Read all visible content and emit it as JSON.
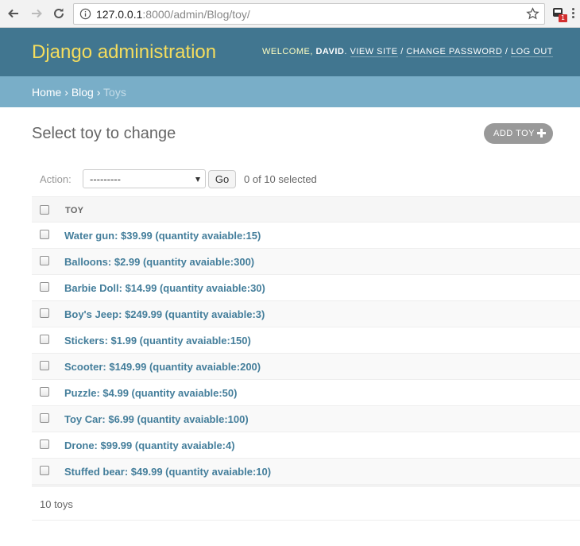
{
  "browser": {
    "url_host": "127.0.0.1",
    "url_rest": ":8000/admin/Blog/toy/",
    "extension_badge": "1"
  },
  "header": {
    "branding": "Django administration",
    "welcome": "Welcome,",
    "username": "David",
    "view_site": "View site",
    "change_password": "Change password",
    "log_out": "Log out"
  },
  "breadcrumbs": {
    "home": "Home",
    "app": "Blog",
    "current": "Toys"
  },
  "main": {
    "title": "Select toy to change",
    "add_button": "Add toy"
  },
  "actions": {
    "label": "Action:",
    "selected_option": "---------",
    "go_label": "Go",
    "counter": "0 of 10 selected"
  },
  "table": {
    "column_header": "Toy",
    "rows": [
      "Water gun: $39.99 (quantity avaiable:15)",
      "Balloons: $2.99 (quantity avaiable:300)",
      "Barbie Doll: $14.99 (quantity avaiable:30)",
      "Boy's Jeep: $249.99 (quantity avaiable:3)",
      "Stickers: $1.99 (quantity avaiable:150)",
      "Scooter: $149.99 (quantity avaiable:200)",
      "Puzzle: $4.99 (quantity avaiable:50)",
      "Toy Car: $6.99 (quantity avaiable:100)",
      "Drone: $99.99 (quantity avaiable:4)",
      "Stuffed bear: $49.99 (quantity avaiable:10)"
    ]
  },
  "paginator": {
    "count": "10 toys"
  },
  "colors": {
    "header_bg": "#417690",
    "branding": "#f5dd5d",
    "breadcrumbs_bg": "#79aec8",
    "link": "#447e9b"
  }
}
